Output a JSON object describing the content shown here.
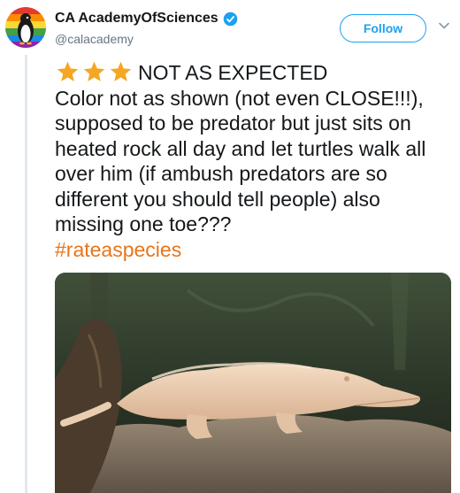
{
  "account": {
    "display_name": "CA AcademyOfSciences",
    "handle": "@calacademy",
    "verified": true
  },
  "follow_button": {
    "label": "Follow"
  },
  "tweet": {
    "rating_stars": 3,
    "headline": "NOT AS EXPECTED",
    "body": "Color not as shown (not even CLOSE!!!), supposed to be predator but just sits on heated rock all day and let turtles walk all over him (if ambush predators are so different you should tell people) also missing one toe???",
    "hashtag": "#rateaspecies"
  },
  "colors": {
    "accent": "#1da1f2",
    "hashtag": "#e8751a",
    "star": "#f5a623",
    "text": "#14171a",
    "muted": "#657786"
  },
  "icons": {
    "verified": "verified-badge-icon",
    "caret": "chevron-down-icon",
    "star": "star-icon"
  }
}
